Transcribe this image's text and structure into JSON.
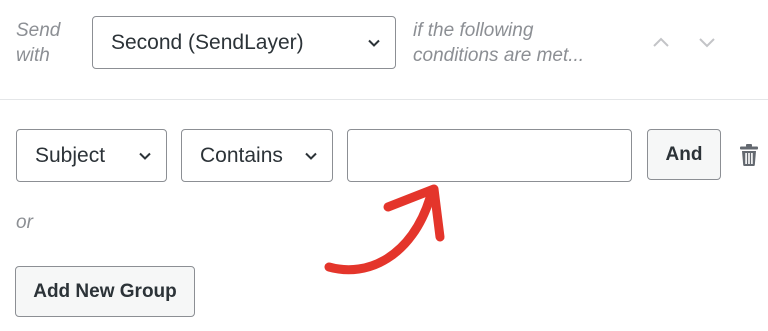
{
  "header": {
    "send_label": "Send with",
    "connection_value": "Second (SendLayer)",
    "conditions_text": "if the following conditions are met..."
  },
  "rule": {
    "field_value": "Subject",
    "operator_value": "Contains",
    "value_input": "",
    "and_label": "And"
  },
  "or_label": "or",
  "add_group_label": "Add New Group",
  "colors": {
    "border": "#8c8f94",
    "muted_text": "#8c8f94",
    "button_bg": "#f6f7f7",
    "annotation": "#e4352b",
    "disabled_arrow": "#c3c4c7"
  },
  "icons": {
    "chevron": "chevron-down-icon",
    "up": "chevron-up-icon",
    "down": "chevron-down-icon",
    "delete": "trash-icon",
    "annotation": "curved-arrow-icon"
  }
}
